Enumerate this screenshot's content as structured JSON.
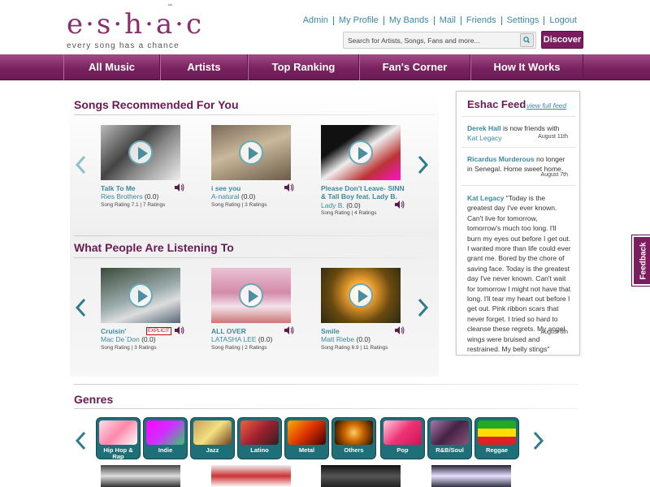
{
  "header": {
    "logo_text": "e·s·h·a·c",
    "tagline": "every song has a chance",
    "tm": "™",
    "links": [
      "Admin",
      "My Profile",
      "My Bands",
      "Mail",
      "Friends",
      "Settings",
      "Logout"
    ],
    "search_placeholder": "Search for Artists, Songs, Fans and more...",
    "discover_label": "Discover"
  },
  "nav": [
    "All Music",
    "Artists",
    "Top Ranking",
    "Fan's Corner",
    "How It Works"
  ],
  "recommended": {
    "title": "Songs Recommended For You",
    "songs": [
      {
        "title": "Talk To Me",
        "artist": "Ries Brothers",
        "score": "(0.0)",
        "rating": "Song Rating 7.1 | 7 Ratings"
      },
      {
        "title": "i see you",
        "artist": "A-natural",
        "score": "(0.0)",
        "rating": "Song Rating | 3 Ratings"
      },
      {
        "title": "Please Don't Leave- SINN & Tall Boy feat. Lady B.",
        "artist": "Lady B.",
        "score": "(0.0)",
        "rating": "Song Rating | 4 Ratings"
      }
    ]
  },
  "listening": {
    "title": "What People Are Listening To",
    "songs": [
      {
        "title": "Cruisin'",
        "explicit": "EXPLICIT",
        "artist": "Mac De`Don",
        "score": "(0.0)",
        "rating": "Song Rating | 3 Ratings"
      },
      {
        "title": "ALL OVER",
        "artist": "LATASHA LEE",
        "score": "(0.0)",
        "rating": "Song Rating | 2 Ratings"
      },
      {
        "title": "Smile",
        "artist": "Matt Riebe",
        "score": "(0.0)",
        "rating": "Song Rating 6.9 | 11 Ratings"
      }
    ]
  },
  "feed": {
    "title": "Eshac Feed",
    "view_full": "view full feed",
    "items": [
      {
        "name": "Derek Hall",
        "text": " is now friends with ",
        "link": "Kat Legacy",
        "date": "August 11th"
      },
      {
        "name": "Ricardus Murderous",
        "text": " no longer in Senegal. Home sweet home.",
        "date": "August 7th"
      },
      {
        "name": "Kat Legacy",
        "text": " \"Today is the greatest day I've ever known. Can't live for tomorrow, tomorrow's much too long. I'll burn my eyes out before I get out. I wanted more than life could ever grant me. Bored by the chore of saving face. Today is the greatest day I've never known. Can't wait for tomorrow I might not have that long. I'll tear my heart out before I get out. Pink ribbon scars that never forget. I tried so hard to cleanse these regrets. My angel wings were bruised and restrained. My belly stings\"",
        "date": "August 6th"
      }
    ]
  },
  "genres": {
    "title": "Genres",
    "items": [
      "Hip Hop & Rap",
      "Indie",
      "Jazz",
      "Latino",
      "Metal",
      "Others",
      "Pop",
      "R&B/Soul",
      "Reggae"
    ]
  },
  "feedback_label": "Feedback",
  "colors": {
    "brand": "#7b1d5e",
    "link": "#3a8a9e",
    "genre_tile": "#1f6f78"
  }
}
